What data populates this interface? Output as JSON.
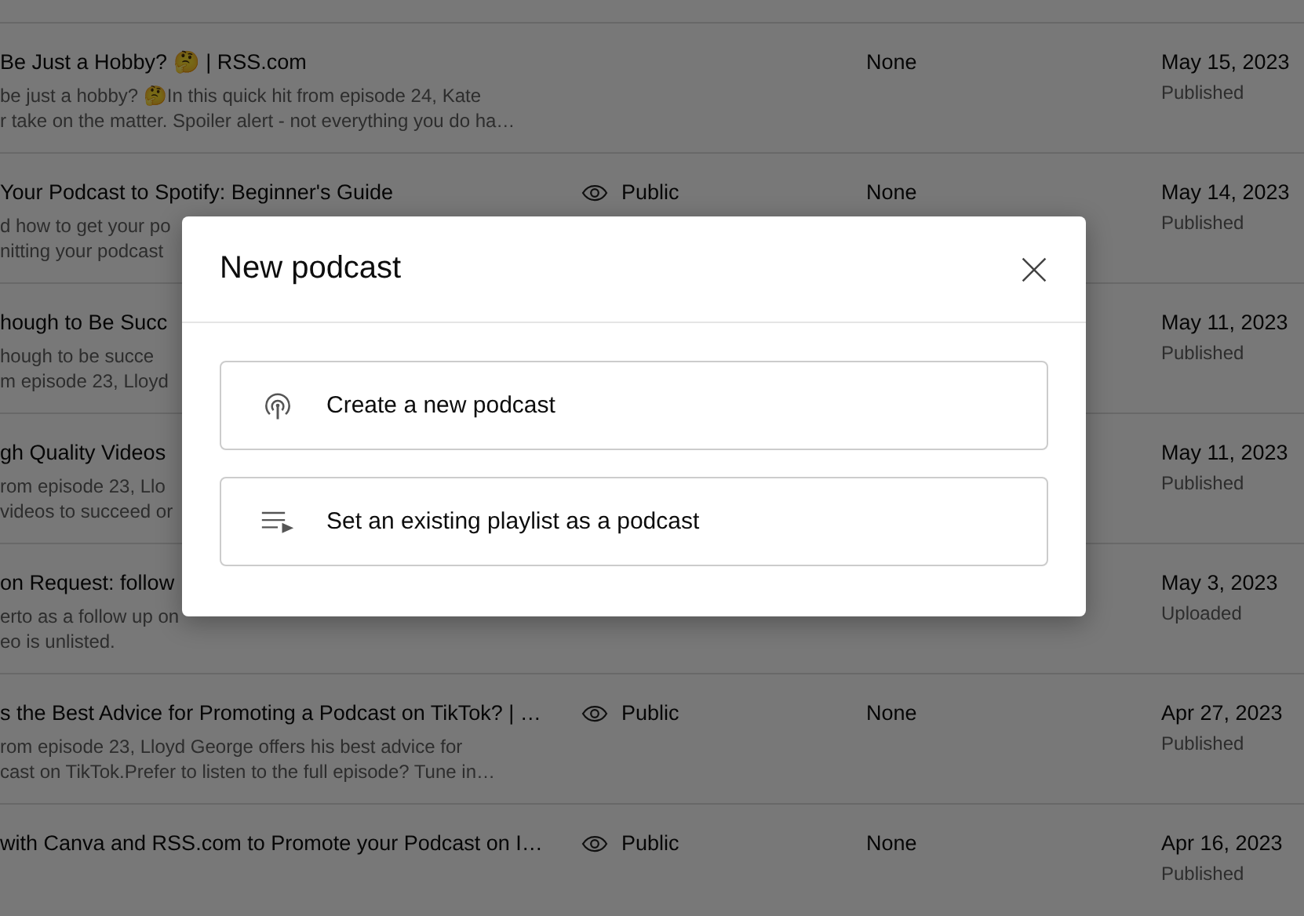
{
  "rows": [
    {
      "title": "Be Just a Hobby? 🤔 | RSS.com",
      "description": [
        "be just a hobby? 🤔In this quick hit from episode 24, Kate",
        "r take on the matter. Spoiler alert - not everything you do ha…"
      ],
      "restrictions": "None",
      "date": "May 15, 2023",
      "status": "Published"
    },
    {
      "title": "Your Podcast to Spotify: Beginner's Guide",
      "description": [
        "d how to get your po",
        "nitting your podcast"
      ],
      "visibility": "Public",
      "restrictions": "None",
      "date": "May 14, 2023",
      "status": "Published"
    },
    {
      "title": "hough to Be Succ",
      "description": [
        "hough to be succe",
        "m episode 23, Lloyd"
      ],
      "date": "May 11, 2023",
      "status": "Published"
    },
    {
      "title": "gh Quality Videos",
      "description": [
        "rom episode 23, Llo",
        "videos to succeed or"
      ],
      "date": "May 11, 2023",
      "status": "Published"
    },
    {
      "title": "on Request: follow",
      "description": [
        "erto as a follow up on",
        "eo is unlisted."
      ],
      "date": "May 3, 2023",
      "status": "Uploaded"
    },
    {
      "title": "s the Best Advice for Promoting a Podcast on TikTok? | …",
      "description": [
        "rom episode 23, Lloyd George offers his best advice for",
        "cast on TikTok.Prefer to listen to the full episode? Tune in…"
      ],
      "visibility": "Public",
      "restrictions": "None",
      "date": "Apr 27, 2023",
      "status": "Published"
    },
    {
      "title": "with Canva and RSS.com to Promote your Podcast on I…",
      "description": [],
      "visibility": "Public",
      "restrictions": "None",
      "date": "Apr 16, 2023",
      "status": "Published"
    }
  ],
  "dialog": {
    "title": "New podcast",
    "options": [
      {
        "kind": "podcast",
        "label": "Create a new podcast"
      },
      {
        "kind": "playlist",
        "label": "Set an existing playlist as a podcast"
      }
    ]
  }
}
